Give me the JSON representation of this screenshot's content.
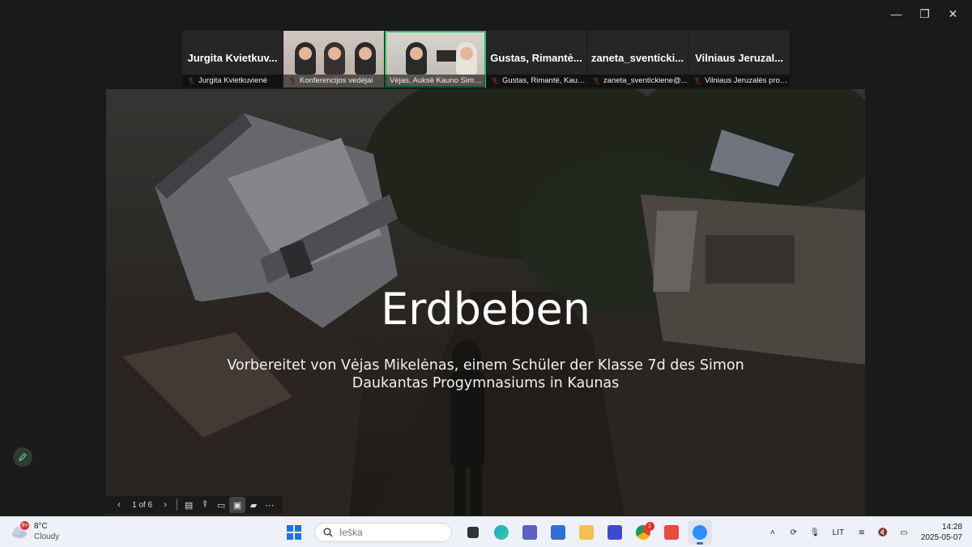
{
  "window": {
    "minimize": "—",
    "restore": "❐",
    "close": "✕"
  },
  "participants": [
    {
      "big": "Jurgita Kvietkuv...",
      "caption": "Jurgita Kvietkuvienė",
      "video": false
    },
    {
      "big": "",
      "caption": "Konferencijos vedėjai",
      "video": true
    },
    {
      "big": "",
      "caption": "Vėjas, Auksė Kauno Simon...",
      "video": true,
      "active": true
    },
    {
      "big": "Gustas, Rimantė...",
      "caption": "Gustas, Rimantė, Kaun...",
      "video": false
    },
    {
      "big": "zaneta_sventicki...",
      "caption": "zaneta_sventickiene@...",
      "video": false
    },
    {
      "big": "Vilniaus Jeruzal...",
      "caption": "Vilniaus Jeruzalės prog...",
      "video": false
    }
  ],
  "slide": {
    "title": "Erdbeben",
    "subtitle": "Vorbereitet von Vėjas Mikelėnas, einem Schüler der Klasse 7d des Simon Daukantas Progymnasiums in Kaunas"
  },
  "slide_toolbar": {
    "page": "1 of 6"
  },
  "taskbar": {
    "weather": {
      "temp": "8°C",
      "cond": "Cloudy",
      "badge": "9+"
    },
    "search_placeholder": "Ieška",
    "tray": {
      "lang": "LIT",
      "time": "14:28",
      "date": "2025-05-07"
    },
    "chrome_badge": "1"
  },
  "colors": {
    "active_tile_border": "#22c55e",
    "taskbar_bg": "#eef1f7"
  }
}
